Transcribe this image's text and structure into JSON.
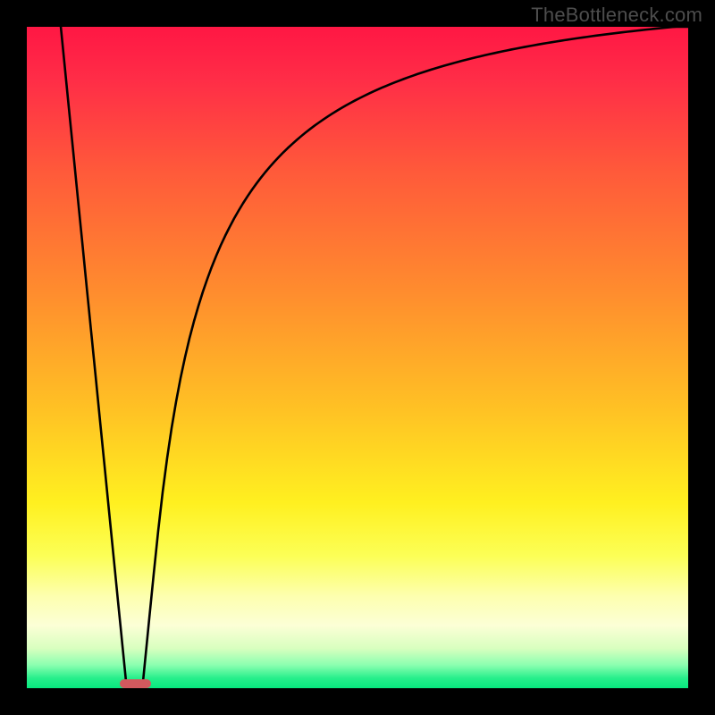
{
  "watermark": "TheBottleneck.com",
  "chart_data": {
    "type": "line",
    "title": "",
    "xlabel": "",
    "ylabel": "",
    "xlim": [
      0,
      100
    ],
    "ylim": [
      0,
      100
    ],
    "grid": false,
    "background_gradient": {
      "stops": [
        {
          "pos": 0.0,
          "color": "#ff1744"
        },
        {
          "pos": 0.08,
          "color": "#ff2d47"
        },
        {
          "pos": 0.22,
          "color": "#ff5a3a"
        },
        {
          "pos": 0.4,
          "color": "#ff8c2e"
        },
        {
          "pos": 0.58,
          "color": "#ffc224"
        },
        {
          "pos": 0.72,
          "color": "#fff020"
        },
        {
          "pos": 0.8,
          "color": "#fcff56"
        },
        {
          "pos": 0.86,
          "color": "#fdffae"
        },
        {
          "pos": 0.905,
          "color": "#fcffd6"
        },
        {
          "pos": 0.94,
          "color": "#d8ffbf"
        },
        {
          "pos": 0.965,
          "color": "#8bffb0"
        },
        {
          "pos": 0.985,
          "color": "#26ef8b"
        },
        {
          "pos": 1.0,
          "color": "#07e87e"
        }
      ]
    },
    "series": [
      {
        "name": "left-branch",
        "x": [
          5.14,
          5.68,
          6.35,
          7.03,
          7.7,
          8.38,
          9.05,
          9.73,
          10.41,
          11.08,
          11.76,
          12.43,
          13.11,
          13.78,
          14.19,
          14.46,
          14.73,
          15.0,
          15.54
        ],
        "y": [
          100.0,
          94.58,
          87.8,
          81.02,
          74.24,
          67.46,
          60.68,
          53.9,
          47.12,
          40.34,
          33.56,
          26.77,
          19.99,
          13.21,
          9.15,
          6.44,
          3.73,
          1.02,
          0.34
        ]
      },
      {
        "name": "right-branch",
        "x": [
          17.3,
          17.57,
          17.84,
          18.11,
          18.51,
          19.19,
          19.86,
          20.54,
          21.22,
          21.89,
          22.57,
          23.24,
          23.92,
          24.59,
          25.27,
          25.95,
          26.62,
          27.3,
          27.97,
          28.65,
          29.32,
          30.0,
          30.68,
          31.35,
          32.03,
          32.7,
          33.38,
          34.05,
          34.73,
          35.41,
          36.08,
          36.76,
          37.43,
          38.11,
          38.78,
          39.46,
          40.14,
          40.81,
          41.49,
          42.16,
          42.84,
          43.51,
          44.19,
          44.86,
          45.54,
          46.22,
          46.89,
          47.57,
          48.24,
          48.92,
          49.59,
          50.27,
          50.95,
          51.62,
          52.3,
          52.97,
          53.65,
          54.32,
          55.0,
          55.68,
          56.35,
          57.03,
          57.7,
          58.38,
          59.05,
          59.73,
          60.41,
          61.08,
          61.76,
          62.43,
          63.11,
          63.78,
          64.46,
          65.14,
          65.81,
          66.49,
          67.16,
          67.84,
          68.51,
          69.19,
          69.86,
          70.54,
          71.22,
          71.89,
          72.57,
          73.24,
          73.92,
          74.59,
          75.27,
          75.95,
          76.62,
          77.3,
          77.97,
          78.65,
          79.32,
          80.0,
          80.68,
          81.35,
          82.03,
          82.7,
          83.38,
          84.05,
          84.73,
          85.41,
          86.08,
          86.76,
          87.43,
          88.11,
          88.78,
          89.46,
          90.14,
          90.81,
          91.49,
          92.16,
          92.84,
          93.51,
          94.19,
          94.86,
          95.54,
          96.22,
          96.89,
          97.57,
          98.24,
          98.92,
          99.59,
          100.0
        ],
        "y": [
          0.34,
          1.02,
          3.73,
          6.44,
          10.51,
          17.29,
          23.73,
          29.64,
          34.81,
          39.32,
          43.32,
          46.86,
          50.03,
          52.88,
          55.45,
          57.8,
          59.94,
          61.91,
          63.72,
          65.4,
          66.96,
          68.41,
          69.76,
          71.03,
          72.21,
          73.33,
          74.38,
          75.37,
          76.31,
          77.2,
          78.04,
          78.84,
          79.6,
          80.32,
          81.01,
          81.67,
          82.29,
          82.89,
          83.47,
          84.02,
          84.55,
          85.06,
          85.54,
          86.01,
          86.46,
          86.9,
          87.31,
          87.72,
          88.11,
          88.48,
          88.84,
          89.19,
          89.53,
          89.86,
          90.17,
          90.48,
          90.78,
          91.06,
          91.34,
          91.61,
          91.87,
          92.13,
          92.37,
          92.61,
          92.85,
          93.07,
          93.29,
          93.51,
          93.72,
          93.92,
          94.12,
          94.31,
          94.5,
          94.68,
          94.86,
          95.03,
          95.2,
          95.37,
          95.53,
          95.69,
          95.84,
          95.99,
          96.14,
          96.28,
          96.42,
          96.56,
          96.69,
          96.82,
          96.95,
          97.08,
          97.2,
          97.32,
          97.44,
          97.55,
          97.66,
          97.77,
          97.88,
          97.99,
          98.09,
          98.19,
          98.29,
          98.39,
          98.48,
          98.58,
          98.67,
          98.76,
          98.84,
          98.93,
          99.01,
          99.1,
          99.18,
          99.26,
          99.33,
          99.41,
          99.48,
          99.56,
          99.63,
          99.7,
          99.77,
          99.84,
          99.9,
          99.97,
          100.0,
          100.0,
          100.0,
          100.0
        ]
      }
    ],
    "marker": {
      "x_center": 16.4,
      "y_center": 0.7,
      "width_x": 4.8,
      "height_y": 1.4,
      "color": "#d1595e"
    }
  }
}
